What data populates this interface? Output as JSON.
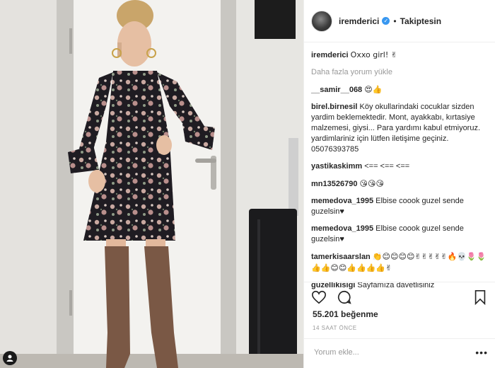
{
  "post": {
    "username": "iremderici",
    "follow_status": "Takiptesin",
    "load_more_label": "Daha fazla yorum yükle",
    "likes_text": "55.201 beğenme",
    "time_text": "14 SAAT ÖNCE",
    "comment_placeholder": "Yorum ekle...",
    "more_label": "•••"
  },
  "comments": [
    {
      "user": "iremderici",
      "text": "Oxxo girl! ✌"
    },
    {
      "user": "__samir__068",
      "text": "😍👍"
    },
    {
      "user": "birel.birnesil",
      "text": "Köy okullarindaki cocuklar sizden yardim beklemektedir. Mont, ayakkabı, kırtasiye malzemesi, giysi... Para yardımı kabul etmiyoruz. yardimlariniz için lütfen iletişime geçiniz. 05076393785"
    },
    {
      "user": "yastikaskimm",
      "text": "<== <== <=="
    },
    {
      "user": "mn13526790",
      "text": "😘😘😘"
    },
    {
      "user": "memedova_1995",
      "text": "Elbise coook guzel sende guzelsin♥"
    },
    {
      "user": "memedova_1995",
      "text": "Elbise coook guzel sende guzelsin♥"
    },
    {
      "user": "tamerkisaarslan",
      "text": "👏😊😊😊😊✌✌✌✌✌🔥💀🌷🌷👍👍😊😊👍👍👍👍✌"
    },
    {
      "user": "guzellikisigi",
      "text": "Sayfamıza davetlisiniz"
    }
  ]
}
